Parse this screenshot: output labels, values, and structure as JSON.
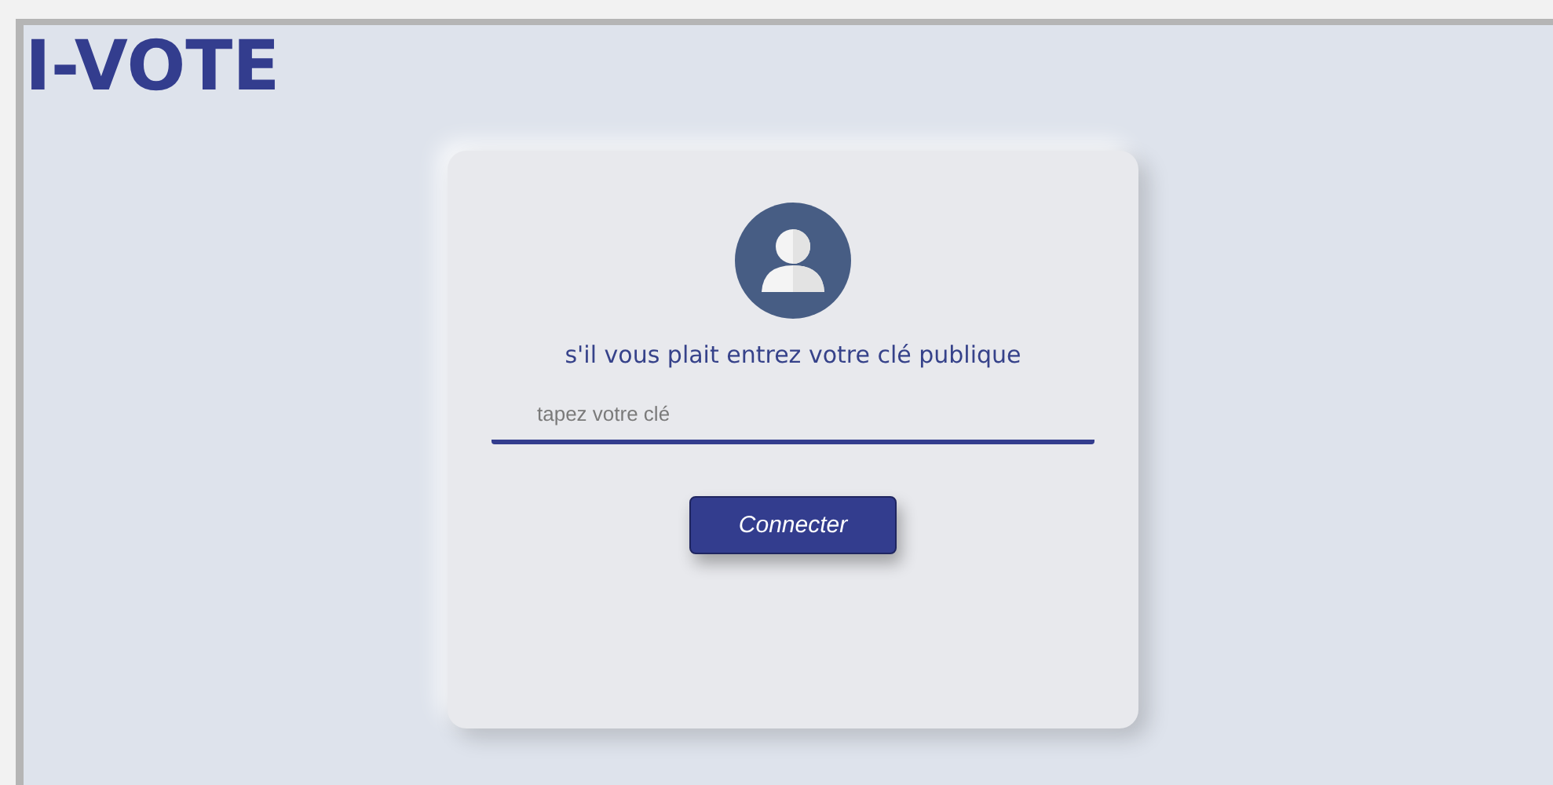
{
  "title": "I-VOTE",
  "login": {
    "prompt": "s'il vous plait entrez votre clé publique",
    "key_field": {
      "placeholder": "tapez votre clé"
    },
    "button": "Connecter"
  }
}
